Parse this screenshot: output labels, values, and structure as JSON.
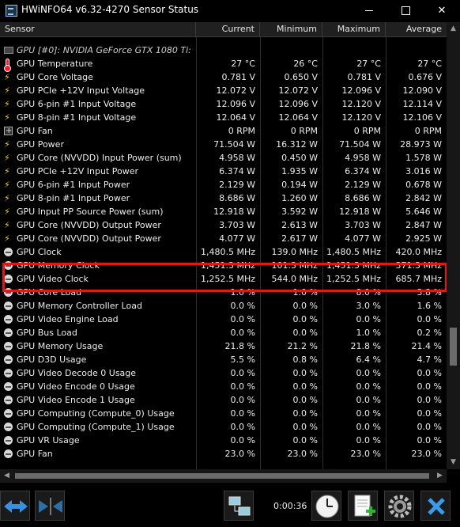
{
  "window": {
    "title": "HWiNFO64 v6.32-4270 Sensor Status"
  },
  "columns": {
    "sensor": "Sensor",
    "current": "Current",
    "minimum": "Minimum",
    "maximum": "Maximum",
    "average": "Average"
  },
  "group": {
    "title": "GPU [#0]: NVIDIA GeForce GTX 1080 Ti:"
  },
  "rows": [
    {
      "icon": "thermometer-icon",
      "name": "GPU Temperature",
      "current": "27 °C",
      "minimum": "26 °C",
      "maximum": "27 °C",
      "average": "27 °C"
    },
    {
      "icon": "lightning-icon",
      "name": "GPU Core Voltage",
      "current": "0.781 V",
      "minimum": "0.650 V",
      "maximum": "0.781 V",
      "average": "0.676 V"
    },
    {
      "icon": "lightning-icon",
      "name": "GPU PCIe +12V Input Voltage",
      "current": "12.072 V",
      "minimum": "12.072 V",
      "maximum": "12.096 V",
      "average": "12.090 V"
    },
    {
      "icon": "lightning-icon",
      "name": "GPU 6-pin #1 Input Voltage",
      "current": "12.096 V",
      "minimum": "12.096 V",
      "maximum": "12.120 V",
      "average": "12.114 V"
    },
    {
      "icon": "lightning-icon",
      "name": "GPU 8-pin #1 Input Voltage",
      "current": "12.064 V",
      "minimum": "12.064 V",
      "maximum": "12.120 V",
      "average": "12.106 V"
    },
    {
      "icon": "fan-icon",
      "name": "GPU Fan",
      "current": "0 RPM",
      "minimum": "0 RPM",
      "maximum": "0 RPM",
      "average": "0 RPM"
    },
    {
      "icon": "lightning-icon",
      "name": "GPU Power",
      "current": "71.504 W",
      "minimum": "16.312 W",
      "maximum": "71.504 W",
      "average": "28.973 W"
    },
    {
      "icon": "lightning-icon",
      "name": "GPU Core (NVVDD) Input Power (sum)",
      "current": "4.958 W",
      "minimum": "0.450 W",
      "maximum": "4.958 W",
      "average": "1.578 W"
    },
    {
      "icon": "lightning-icon",
      "name": "GPU PCIe +12V Input Power",
      "current": "6.374 W",
      "minimum": "1.935 W",
      "maximum": "6.374 W",
      "average": "3.016 W"
    },
    {
      "icon": "lightning-icon",
      "name": "GPU 6-pin #1 Input Power",
      "current": "2.129 W",
      "minimum": "0.194 W",
      "maximum": "2.129 W",
      "average": "0.678 W"
    },
    {
      "icon": "lightning-icon",
      "name": "GPU 8-pin #1 Input Power",
      "current": "8.686 W",
      "minimum": "1.260 W",
      "maximum": "8.686 W",
      "average": "2.842 W"
    },
    {
      "icon": "lightning-icon",
      "name": "GPU Input PP Source Power (sum)",
      "current": "12.918 W",
      "minimum": "3.592 W",
      "maximum": "12.918 W",
      "average": "5.646 W"
    },
    {
      "icon": "lightning-icon",
      "name": "GPU Core (NVVDD) Output Power",
      "current": "3.703 W",
      "minimum": "2.613 W",
      "maximum": "3.703 W",
      "average": "2.847 W"
    },
    {
      "icon": "lightning-icon",
      "name": "GPU Core (NVVDD) Output Power",
      "current": "4.077 W",
      "minimum": "2.617 W",
      "maximum": "4.077 W",
      "average": "2.925 W"
    },
    {
      "icon": "clock-icon",
      "name": "GPU Clock",
      "current": "1,480.5 MHz",
      "minimum": "139.0 MHz",
      "maximum": "1,480.5 MHz",
      "average": "420.0 MHz"
    },
    {
      "icon": "clock-icon",
      "name": "GPU Memory Clock",
      "current": "1,451.3 MHz",
      "minimum": "101.3 MHz",
      "maximum": "1,451.3 MHz",
      "average": "371.3 MHz"
    },
    {
      "icon": "clock-icon",
      "name": "GPU Video Clock",
      "current": "1,252.5 MHz",
      "minimum": "544.0 MHz",
      "maximum": "1,252.5 MHz",
      "average": "685.7 MHz"
    },
    {
      "icon": "clock-icon",
      "name": "GPU Core Load",
      "current": "1.0 %",
      "minimum": "1.0 %",
      "maximum": "8.0 %",
      "average": "3.8 %"
    },
    {
      "icon": "clock-icon",
      "name": "GPU Memory Controller Load",
      "current": "0.0 %",
      "minimum": "0.0 %",
      "maximum": "3.0 %",
      "average": "1.6 %"
    },
    {
      "icon": "clock-icon",
      "name": "GPU Video Engine Load",
      "current": "0.0 %",
      "minimum": "0.0 %",
      "maximum": "0.0 %",
      "average": "0.0 %"
    },
    {
      "icon": "clock-icon",
      "name": "GPU Bus Load",
      "current": "0.0 %",
      "minimum": "0.0 %",
      "maximum": "1.0 %",
      "average": "0.2 %"
    },
    {
      "icon": "clock-icon",
      "name": "GPU Memory Usage",
      "current": "21.8 %",
      "minimum": "21.2 %",
      "maximum": "21.8 %",
      "average": "21.4 %"
    },
    {
      "icon": "clock-icon",
      "name": "GPU D3D Usage",
      "current": "5.5 %",
      "minimum": "0.8 %",
      "maximum": "6.4 %",
      "average": "4.7 %"
    },
    {
      "icon": "clock-icon",
      "name": "GPU Video Decode 0 Usage",
      "current": "0.0 %",
      "minimum": "0.0 %",
      "maximum": "0.0 %",
      "average": "0.0 %"
    },
    {
      "icon": "clock-icon",
      "name": "GPU Video Encode 0 Usage",
      "current": "0.0 %",
      "minimum": "0.0 %",
      "maximum": "0.0 %",
      "average": "0.0 %"
    },
    {
      "icon": "clock-icon",
      "name": "GPU Video Encode 1 Usage",
      "current": "0.0 %",
      "minimum": "0.0 %",
      "maximum": "0.0 %",
      "average": "0.0 %"
    },
    {
      "icon": "clock-icon",
      "name": "GPU Computing (Compute_0) Usage",
      "current": "0.0 %",
      "minimum": "0.0 %",
      "maximum": "0.0 %",
      "average": "0.0 %"
    },
    {
      "icon": "clock-icon",
      "name": "GPU Computing (Compute_1) Usage",
      "current": "0.0 %",
      "minimum": "0.0 %",
      "maximum": "0.0 %",
      "average": "0.0 %"
    },
    {
      "icon": "clock-icon",
      "name": "GPU VR Usage",
      "current": "0.0 %",
      "minimum": "0.0 %",
      "maximum": "0.0 %",
      "average": "0.0 %"
    },
    {
      "icon": "clock-icon",
      "name": "GPU Fan",
      "current": "23.0 %",
      "minimum": "23.0 %",
      "maximum": "23.0 %",
      "average": "23.0 %"
    }
  ],
  "highlighted_rows": [
    12,
    13
  ],
  "highlight_color": "#e01818",
  "toolbar": {
    "timer": "0:00:36"
  }
}
